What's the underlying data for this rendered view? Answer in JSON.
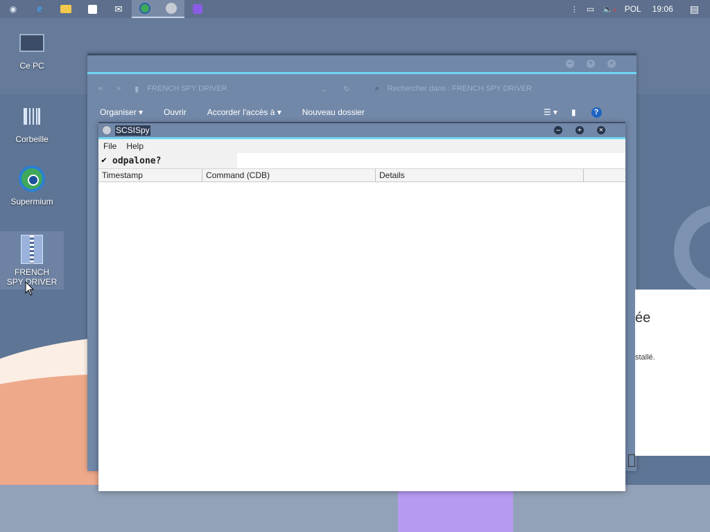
{
  "taskbar": {
    "icons": [
      {
        "name": "cortana-icon",
        "glyph": "◉",
        "color": "#dfe6f0"
      },
      {
        "name": "edge-icon",
        "glyph": "e",
        "color": "#1e78d4"
      },
      {
        "name": "file-explorer-icon",
        "glyph": "▬",
        "color": "#f2c94c"
      },
      {
        "name": "store-icon",
        "glyph": "■",
        "color": "#ffffff"
      },
      {
        "name": "mail-icon",
        "glyph": "✉",
        "color": "#ffffff"
      },
      {
        "name": "supermium-icon",
        "glyph": "●",
        "color": "#3fa85a"
      },
      {
        "name": "scsispy-icon",
        "glyph": "●",
        "color": "#c7ccd4"
      },
      {
        "name": "visual-studio-icon",
        "glyph": "◆",
        "color": "#8a5ce6"
      }
    ],
    "tray": {
      "language": "POL",
      "time": "19:06"
    }
  },
  "desktop_icons": [
    {
      "label": "Ce PC",
      "icon": "monitor-icon"
    },
    {
      "label": "Corbeille",
      "icon": "recycle-bin-icon"
    },
    {
      "label": "Supermium",
      "icon": "supermium-icon"
    },
    {
      "label": "FRENCH SPY DRIVER",
      "icon": "folder-zip-icon"
    }
  ],
  "explorer": {
    "path": "FRENCH SPY DRIVER",
    "search_placeholder": "Rechercher dans : FRENCH SPY DRIVER",
    "toolbar": {
      "organize": "Organiser",
      "open": "Ouvrir",
      "share": "Accorder l'accès à",
      "new_folder": "Nouveau dossier"
    }
  },
  "setup_dialog": {
    "heading_fragment": "ée",
    "text_fragment": "stallé."
  },
  "scsispy": {
    "title": "SCSISpy",
    "menu": {
      "file": "File",
      "help": "Help"
    },
    "option": {
      "label": "odpalone?",
      "checked": true,
      "check_glyph": "✔"
    },
    "columns": [
      "Timestamp",
      "Command (CDB)",
      "Details"
    ],
    "rows": []
  }
}
